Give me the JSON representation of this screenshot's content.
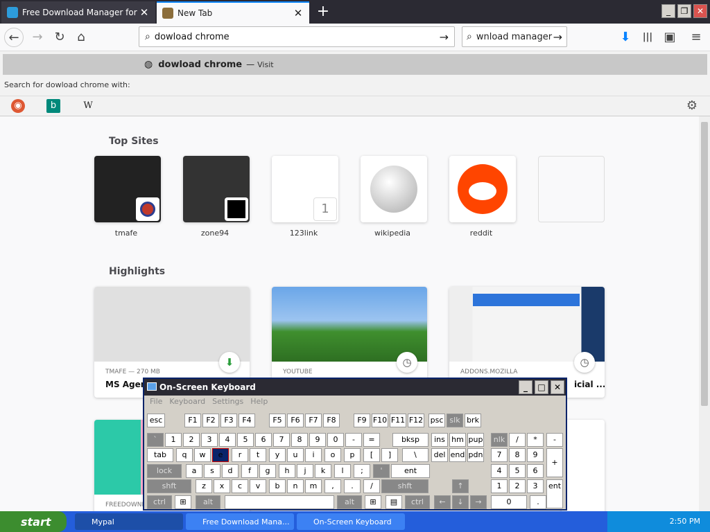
{
  "tabs": [
    {
      "title": "Free Download Manager for Windo",
      "close": "✕"
    },
    {
      "title": "New Tab",
      "close": "✕"
    }
  ],
  "new_tab_glyph": "+",
  "window_controls": [
    "_",
    "❐",
    "✕"
  ],
  "nav": {
    "back": "←",
    "forward": "→",
    "reload": "↻",
    "home": "⌂",
    "url_value": "dowload chrome",
    "go": "→",
    "search_value": "wnload manager",
    "search_go": "→",
    "download_icon": "⬇",
    "library_icon": "|||",
    "sidebar_icon": "▣",
    "menu_icon": "≡"
  },
  "dropdown": {
    "suggestion": "dowload chrome",
    "dash": "—",
    "visit": "Visit",
    "search_for_prefix": "Search for",
    "search_for_query": "dowload chrome",
    "search_for_suffix": "with:",
    "engines": [
      "DuckDuckGo",
      "Bing",
      "Wikipedia"
    ],
    "engine_glyphs": [
      "◉",
      "b",
      "W"
    ],
    "settings_icon": "⚙"
  },
  "top_sites": {
    "heading": "Top Sites",
    "sites": [
      {
        "label": "tmafe"
      },
      {
        "label": "zone94"
      },
      {
        "label": "123link",
        "badge": "1"
      },
      {
        "label": "wikipedia"
      },
      {
        "label": "reddit"
      },
      {
        "label": ""
      }
    ]
  },
  "highlights": {
    "heading": "Highlights",
    "cards": [
      {
        "meta": "TMAFE — 270 MB",
        "title": "MS Agent"
      },
      {
        "meta": "YOUTUBE",
        "title": ""
      },
      {
        "meta": "ADDONS.MOZILLA",
        "title": "icial ..."
      }
    ],
    "second_row": [
      {
        "meta": "FREEDOWNL"
      }
    ]
  },
  "osk": {
    "title": "On-Screen Keyboard",
    "menu": [
      "File",
      "Keyboard",
      "Settings",
      "Help"
    ],
    "controls": [
      "_",
      "□",
      "✕"
    ],
    "row_fn": [
      "esc",
      "F1",
      "F2",
      "F3",
      "F4",
      "F5",
      "F6",
      "F7",
      "F8",
      "F9",
      "F10",
      "F11",
      "F12",
      "psc",
      "slk",
      "brk"
    ],
    "row_num": [
      "`",
      "1",
      "2",
      "3",
      "4",
      "5",
      "6",
      "7",
      "8",
      "9",
      "0",
      "-",
      "=",
      "bksp",
      "ins",
      "hm",
      "pup",
      "nlk",
      "/",
      "*",
      "-"
    ],
    "row_q": [
      "tab",
      "q",
      "w",
      "e",
      "r",
      "t",
      "y",
      "u",
      "i",
      "o",
      "p",
      "[",
      "]",
      "\\",
      "del",
      "end",
      "pdn",
      "7",
      "8",
      "9",
      "+"
    ],
    "row_a": [
      "lock",
      "a",
      "s",
      "d",
      "f",
      "g",
      "h",
      "j",
      "k",
      "l",
      ";",
      "'",
      "ent",
      "4",
      "5",
      "6"
    ],
    "row_z": [
      "shft",
      "z",
      "x",
      "c",
      "v",
      "b",
      "n",
      "m",
      ",",
      ".",
      "/",
      "shft",
      "↑",
      "1",
      "2",
      "3",
      "ent"
    ],
    "row_ctrl": [
      "ctrl",
      "⊞",
      "alt",
      "",
      "alt",
      "⊞",
      "▤",
      "ctrl",
      "←",
      "↓",
      "→",
      "0",
      "."
    ]
  },
  "taskbar": {
    "start": "start",
    "items": [
      "Mypal",
      "Free Download Mana...",
      "On-Screen Keyboard"
    ],
    "clock": "2:50 PM"
  }
}
